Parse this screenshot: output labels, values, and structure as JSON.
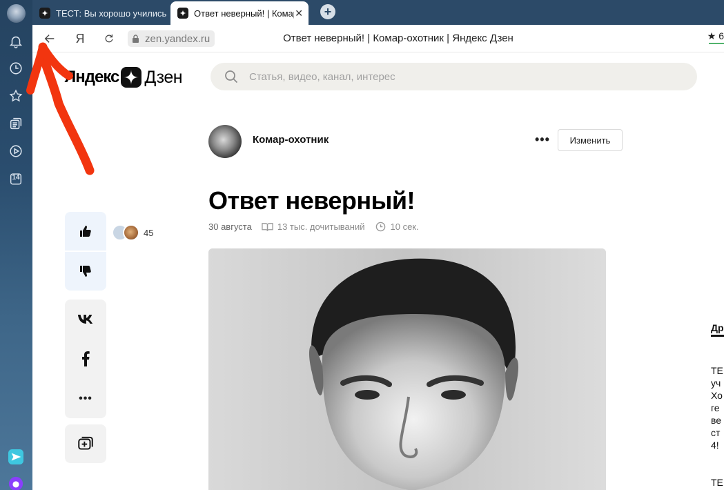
{
  "sidebar": {
    "icons": [
      "profile-avatar",
      "bell-icon",
      "clock-icon",
      "star-icon",
      "collections-icon",
      "play-icon",
      "calendar-icon"
    ],
    "calendar_day": "14",
    "bottom_icons": [
      "messenger-icon",
      "alice-icon"
    ]
  },
  "tabs": [
    {
      "title": "ТЕСТ: Вы хорошо учились",
      "active": false
    },
    {
      "title": "Ответ неверный! | Комар",
      "active": true
    }
  ],
  "address_bar": {
    "url": "zen.yandex.ru",
    "page_title": "Ответ неверный! | Комар-охотник | Яндекс Дзен",
    "yandex_button": "Я",
    "bookmark_text": "★ 6"
  },
  "header": {
    "logo_left": "Яндекс",
    "logo_right": "Дзен",
    "search_placeholder": "Статья, видео, канал, интерес"
  },
  "article": {
    "channel_name": "Комар-охотник",
    "more_label": "•••",
    "edit_label": "Изменить",
    "title": "Ответ неверный!",
    "date": "30 августа",
    "reads": "13 тыс. дочитываний",
    "read_time": "10 сек.",
    "image": "black-and-white portrait photo"
  },
  "actions": {
    "likes_count": "45",
    "share_vk": "vk",
    "share_fb": "f",
    "share_more": "•••"
  },
  "right_sidebar": {
    "heading": "Др",
    "lines": [
      "ТЕ",
      "уч",
      "Хо",
      "ге",
      "ве",
      "ст",
      "4!",
      "",
      "ТЕ"
    ]
  },
  "annotation": {
    "arrow_color": "#f2350f"
  }
}
